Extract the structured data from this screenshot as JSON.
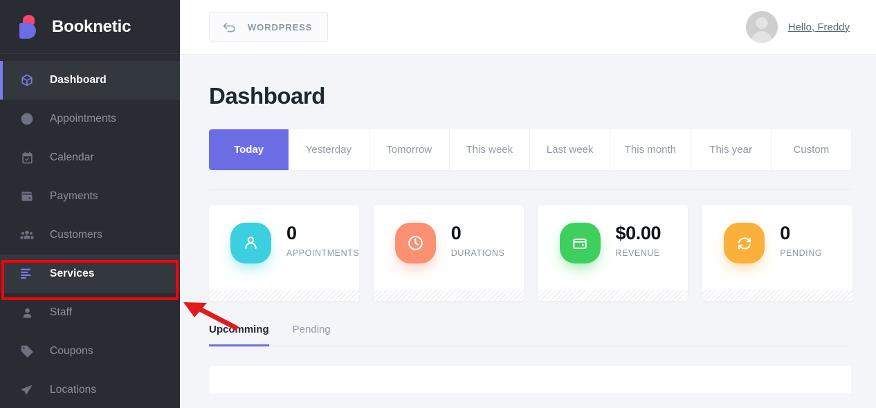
{
  "brand": {
    "name": "Booknetic",
    "logo_icon": "booknetic-b-logo"
  },
  "sidebar": {
    "items": [
      {
        "label": "Dashboard",
        "icon": "cube-icon",
        "state": "active"
      },
      {
        "label": "Appointments",
        "icon": "clock-icon",
        "state": "normal"
      },
      {
        "label": "Calendar",
        "icon": "calendar-icon",
        "state": "normal"
      },
      {
        "label": "Payments",
        "icon": "wallet-icon",
        "state": "normal"
      },
      {
        "label": "Customers",
        "icon": "users-icon",
        "state": "normal"
      },
      {
        "label": "Services",
        "icon": "list-lines-icon",
        "state": "selected"
      },
      {
        "label": "Staff",
        "icon": "person-icon",
        "state": "normal"
      },
      {
        "label": "Coupons",
        "icon": "tag-icon",
        "state": "normal"
      },
      {
        "label": "Locations",
        "icon": "send-icon",
        "state": "normal"
      }
    ]
  },
  "topbar": {
    "wordpress_button": {
      "label": "WORDPRESS",
      "icon": "back-arrow-icon"
    },
    "user": {
      "greeting": "Hello, Freddy",
      "avatar_icon": "avatar-placeholder-icon"
    }
  },
  "page": {
    "title": "Dashboard"
  },
  "filters": {
    "items": [
      {
        "label": "Today",
        "selected": true
      },
      {
        "label": "Yesterday",
        "selected": false
      },
      {
        "label": "Tomorrow",
        "selected": false
      },
      {
        "label": "This week",
        "selected": false
      },
      {
        "label": "Last week",
        "selected": false
      },
      {
        "label": "This month",
        "selected": false
      },
      {
        "label": "This year",
        "selected": false
      },
      {
        "label": "Custom",
        "selected": false
      }
    ]
  },
  "stats": {
    "cards": [
      {
        "value": "0",
        "label": "APPOINTMENTS",
        "icon": "person-icon",
        "color": "#3ccfe0"
      },
      {
        "value": "0",
        "label": "DURATIONS",
        "icon": "clock-icon",
        "color": "#fb9073"
      },
      {
        "value": "$0.00",
        "label": "REVENUE",
        "icon": "wallet-icon",
        "color": "#3fcf5f"
      },
      {
        "value": "0",
        "label": "PENDING",
        "icon": "refresh-icon",
        "color": "#fbb03b"
      }
    ]
  },
  "sub_tabs": {
    "items": [
      {
        "label": "Upcomming",
        "selected": true
      },
      {
        "label": "Pending",
        "selected": false
      }
    ]
  },
  "annotations": {
    "highlight_box": {
      "target": "sidebar-item-services",
      "color": "#fb0007"
    },
    "arrow": {
      "points_to": "sidebar-item-services",
      "color": "#e01c1c"
    }
  }
}
